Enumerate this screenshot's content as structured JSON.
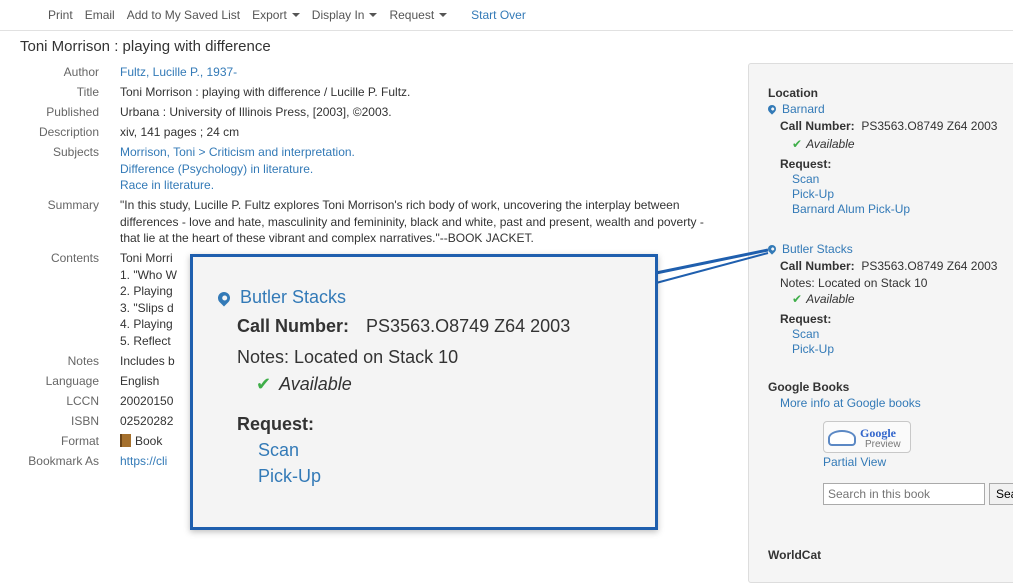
{
  "toolbar": {
    "items": [
      {
        "label": "Print"
      },
      {
        "label": "Email"
      },
      {
        "label": "Add to My Saved List"
      },
      {
        "label": "Export"
      },
      {
        "label": "Display In"
      },
      {
        "label": "Request"
      }
    ],
    "start_over": "Start Over"
  },
  "record": {
    "title": "Toni Morrison : playing with difference",
    "labels": {
      "author": "Author",
      "title": "Title",
      "published": "Published",
      "description": "Description",
      "subjects": "Subjects",
      "summary": "Summary",
      "contents": "Contents",
      "notes": "Notes",
      "language": "Language",
      "lccn": "LCCN",
      "isbn": "ISBN",
      "format": "Format",
      "bookmark": "Bookmark As"
    },
    "author": "Fultz, Lucille P., 1937-",
    "title_value": "Toni Morrison : playing with difference / Lucille P. Fultz.",
    "published": "Urbana : University of Illinois Press, [2003], ©2003.",
    "description": "xiv, 141 pages ; 24 cm",
    "subjects": [
      "Morrison, Toni > Criticism and interpretation.",
      "Difference (Psychology) in literature.",
      "Race in literature."
    ],
    "summary": "\"In this study, Lucille P. Fultz explores Toni Morrison's rich body of work, uncovering the interplay between differences - love and hate, masculinity and femininity, black and white, past and present, wealth and poverty - that lie at the heart of these vibrant and complex narratives.\"--BOOK JACKET.",
    "contents": [
      "Toni Morri",
      "1. \"Who W",
      "2. Playing",
      "3. \"Slips d",
      "4. Playing",
      "5. Reflect"
    ],
    "notes": "Includes b",
    "language": "English",
    "lccn": "20020150",
    "isbn": "02520282",
    "format": "Book",
    "bookmark": "https://cli"
  },
  "sidebar": {
    "location_heading": "Location",
    "call_number_label": "Call Number:",
    "request_label": "Request:",
    "locations": [
      {
        "name": "Barnard",
        "call_number": "PS3563.O8749 Z64 2003",
        "status": "Available",
        "requests": [
          "Scan",
          "Pick-Up",
          "Barnard Alum Pick-Up"
        ]
      },
      {
        "name": "Butler Stacks",
        "call_number": "PS3563.O8749 Z64 2003",
        "notes": "Notes: Located on Stack 10",
        "status": "Available",
        "requests": [
          "Scan",
          "Pick-Up"
        ]
      }
    ],
    "google_books": {
      "heading": "Google Books",
      "more_info": "More info at Google books",
      "btn_google": "Google",
      "btn_preview": "Preview",
      "partial_view": "Partial View",
      "search_placeholder": "Search in this book",
      "search_button": "Sea"
    },
    "worldcat_heading": "WorldCat"
  },
  "zoom": {
    "name": "Butler Stacks",
    "call_number_label": "Call Number:",
    "call_number": "PS3563.O8749 Z64 2003",
    "notes": "Notes: Located on Stack 10",
    "status": "Available",
    "request_label": "Request:",
    "requests": [
      "Scan",
      "Pick-Up"
    ],
    "frame_color": "#1f5fae"
  },
  "colors": {
    "link": "#337ab7",
    "available_check": "#3fae49"
  }
}
